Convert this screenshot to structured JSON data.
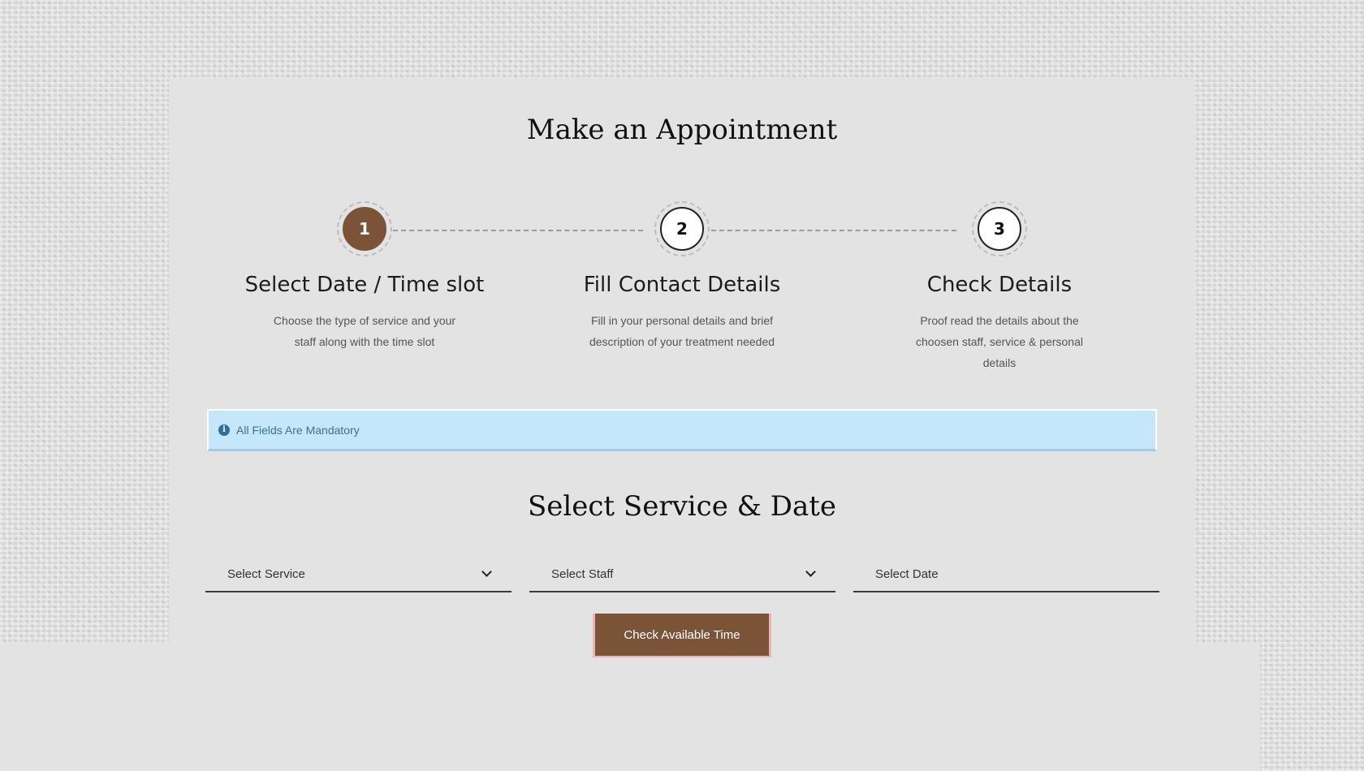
{
  "page": {
    "title": "Make an Appointment"
  },
  "steps": [
    {
      "number": "1",
      "title": "Select Date / Time slot",
      "description": "Choose the type of service and your staff along with the time slot",
      "active": true
    },
    {
      "number": "2",
      "title": "Fill Contact Details",
      "description": "Fill in your personal details and brief description of your treatment needed",
      "active": false
    },
    {
      "number": "3",
      "title": "Check Details",
      "description": "Proof read the details about the choosen staff, service & personal details",
      "active": false
    }
  ],
  "alert": {
    "icon": "info-icon",
    "text": "All Fields Are Mandatory"
  },
  "form": {
    "section_title": "Select Service & Date",
    "service": {
      "value": "Select Service",
      "icon": "chevron-down-icon"
    },
    "staff": {
      "value": "Select Staff",
      "icon": "chevron-down-icon"
    },
    "date": {
      "placeholder": "Select Date"
    },
    "submit_label": "Check Available Time"
  },
  "colors": {
    "accent": "#7b5337",
    "alert_background": "#c5e7fb",
    "alert_text": "#3d6f93",
    "panel_background": "#e3e3e3"
  }
}
